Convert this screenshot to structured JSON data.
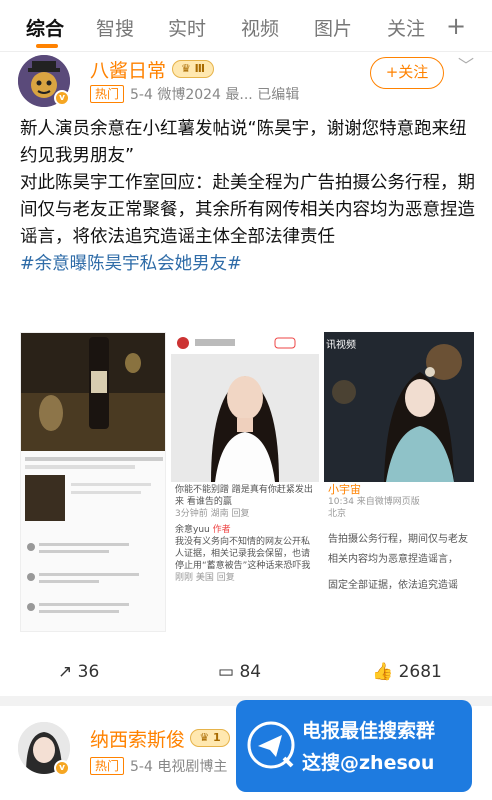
{
  "tabs": [
    "综合",
    "智搜",
    "实时",
    "视频",
    "图片",
    "关注"
  ],
  "post1": {
    "username": "八酱日常",
    "level": "Ⅲ",
    "hot_tag": "热门",
    "meta": "5-4  微博2024 最...  已编辑",
    "follow_label": "+关注",
    "text_lines": [
      "新人演员余意在小红薯发帖说“陈昊宇，谢谢您特意跑来纽约见我男朋友”",
      "对此陈昊宇工作室回应：赴美全程为广告拍摄公务行程，期间仅与老友正常聚餐，其余所有网传相关内容均为恶意捏造谣言，将依法追究造谣主体全部法律责任"
    ],
    "hashtag": "#余意曝陈昊宇私会她男友#",
    "img2": {
      "caption_top": "你能不能别蹭 蹭是真有你赶紧发出来 看谁告的赢",
      "caption_time": "3分钟前  湖南  回复",
      "reply_user": "余意yuu",
      "reply_tag": "作者",
      "reply_text": "我没有义务向不知情的网友公开私人证据，相关记录我会保留，也请停止用“蓄意被告”这种话来恐吓我",
      "reply_meta": "刚刚  美国  回复"
    },
    "img3": {
      "app": "讯视频",
      "user": "小宇宙",
      "time": "10:34  来自微博网页版",
      "loc": "北京",
      "lines": [
        "告拍摄公务行程，期间仅与老友",
        "相关内容均为恶意捏造谣言，",
        "固定全部证据，依法追究造谣"
      ]
    },
    "reposts": "36",
    "comments": "84",
    "likes": "2681"
  },
  "post2": {
    "username": "纳西索斯俊",
    "level": "1",
    "hot_tag": "热门",
    "meta": "5-4  电视剧博主"
  },
  "ad": {
    "line1": "电报最佳搜索群",
    "line2": "这搜@zhesou"
  },
  "colors": {
    "accent": "#ff8200",
    "link": "#2f6ca8",
    "ad_bg": "#1e7be0"
  }
}
